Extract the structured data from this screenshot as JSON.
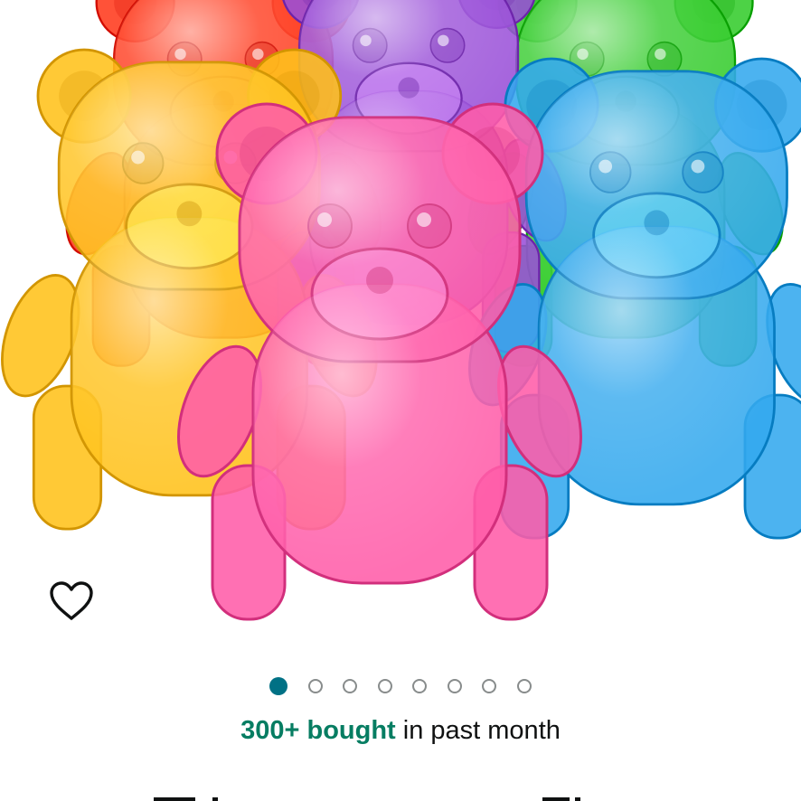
{
  "product_gallery": {
    "image_alt": "",
    "current_image": 1,
    "image_count": 8,
    "bear_colors": {
      "red": "#ff3a1c",
      "purple": "#9a50d8",
      "green": "#34cc2c",
      "yellow": "#ffc21a",
      "blue": "#33a9ee",
      "pink": "#ff5ca9"
    }
  },
  "wishlist": {
    "icon": "heart-outline-icon",
    "color": "#0f1111"
  },
  "pagination": {
    "active_color": "#007185",
    "inactive_border": "#888c8c"
  },
  "social_proof": {
    "count": "300+ bought",
    "suffix": " in past month",
    "count_color": "#067d62",
    "text_color": "#0f1111"
  },
  "bottom_fragments": {
    "color": "#0f1111"
  }
}
